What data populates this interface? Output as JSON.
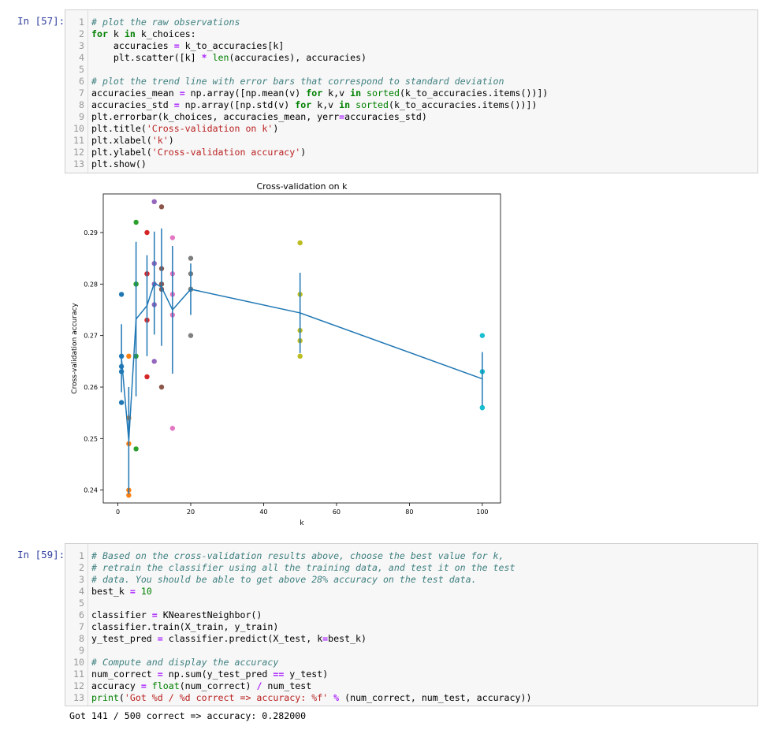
{
  "cell1": {
    "prompt": "In [57]:",
    "lines": [
      {
        "n": "1",
        "parts": [
          [
            "cm",
            "# plot the raw observations"
          ]
        ]
      },
      {
        "n": "2",
        "parts": [
          [
            "kw",
            "for"
          ],
          [
            "code",
            " k "
          ],
          [
            "kw",
            "in"
          ],
          [
            "code",
            " k_choices:"
          ]
        ]
      },
      {
        "n": "3",
        "parts": [
          [
            "code",
            "    accuracies "
          ],
          [
            "op",
            "="
          ],
          [
            "code",
            " k_to_accuracies[k]"
          ]
        ]
      },
      {
        "n": "4",
        "parts": [
          [
            "code",
            "    plt.scatter([k] "
          ],
          [
            "op",
            "*"
          ],
          [
            "code",
            " "
          ],
          [
            "bi",
            "len"
          ],
          [
            "code",
            "(accuracies), accuracies)"
          ]
        ]
      },
      {
        "n": "5",
        "parts": [
          [
            "code",
            ""
          ]
        ]
      },
      {
        "n": "6",
        "parts": [
          [
            "cm",
            "# plot the trend line with error bars that correspond to standard deviation"
          ]
        ]
      },
      {
        "n": "7",
        "parts": [
          [
            "code",
            "accuracies_mean "
          ],
          [
            "op",
            "="
          ],
          [
            "code",
            " np.array([np.mean(v) "
          ],
          [
            "kw",
            "for"
          ],
          [
            "code",
            " k,v "
          ],
          [
            "kw",
            "in"
          ],
          [
            "code",
            " "
          ],
          [
            "bi",
            "sorted"
          ],
          [
            "code",
            "(k_to_accuracies.items())])"
          ]
        ]
      },
      {
        "n": "8",
        "parts": [
          [
            "code",
            "accuracies_std "
          ],
          [
            "op",
            "="
          ],
          [
            "code",
            " np.array([np.std(v) "
          ],
          [
            "kw",
            "for"
          ],
          [
            "code",
            " k,v "
          ],
          [
            "kw",
            "in"
          ],
          [
            "code",
            " "
          ],
          [
            "bi",
            "sorted"
          ],
          [
            "code",
            "(k_to_accuracies.items())])"
          ]
        ]
      },
      {
        "n": "9",
        "parts": [
          [
            "code",
            "plt.errorbar(k_choices, accuracies_mean, yerr"
          ],
          [
            "op",
            "="
          ],
          [
            "code",
            "accuracies_std)"
          ]
        ]
      },
      {
        "n": "10",
        "parts": [
          [
            "code",
            "plt.title("
          ],
          [
            "st",
            "'Cross-validation on k'"
          ],
          [
            "code",
            ")"
          ]
        ]
      },
      {
        "n": "11",
        "parts": [
          [
            "code",
            "plt.xlabel("
          ],
          [
            "st",
            "'k'"
          ],
          [
            "code",
            ")"
          ]
        ]
      },
      {
        "n": "12",
        "parts": [
          [
            "code",
            "plt.ylabel("
          ],
          [
            "st",
            "'Cross-validation accuracy'"
          ],
          [
            "code",
            ")"
          ]
        ]
      },
      {
        "n": "13",
        "parts": [
          [
            "code",
            "plt.show()"
          ]
        ]
      }
    ]
  },
  "cell2": {
    "prompt": "In [59]:",
    "lines": [
      {
        "n": "1",
        "parts": [
          [
            "cm",
            "# Based on the cross-validation results above, choose the best value for k,"
          ]
        ]
      },
      {
        "n": "2",
        "parts": [
          [
            "cm",
            "# retrain the classifier using all the training data, and test it on the test"
          ]
        ]
      },
      {
        "n": "3",
        "parts": [
          [
            "cm",
            "# data. You should be able to get above 28% accuracy on the test data."
          ]
        ]
      },
      {
        "n": "4",
        "parts": [
          [
            "code",
            "best_k "
          ],
          [
            "op",
            "="
          ],
          [
            "code",
            " "
          ],
          [
            "nu",
            "10"
          ]
        ]
      },
      {
        "n": "5",
        "parts": [
          [
            "code",
            ""
          ]
        ]
      },
      {
        "n": "6",
        "parts": [
          [
            "code",
            "classifier "
          ],
          [
            "op",
            "="
          ],
          [
            "code",
            " KNearestNeighbor()"
          ]
        ]
      },
      {
        "n": "7",
        "parts": [
          [
            "code",
            "classifier.train(X_train, y_train)"
          ]
        ]
      },
      {
        "n": "8",
        "parts": [
          [
            "code",
            "y_test_pred "
          ],
          [
            "op",
            "="
          ],
          [
            "code",
            " classifier.predict(X_test, k"
          ],
          [
            "op",
            "="
          ],
          [
            "code",
            "best_k)"
          ]
        ]
      },
      {
        "n": "9",
        "parts": [
          [
            "code",
            ""
          ]
        ]
      },
      {
        "n": "10",
        "parts": [
          [
            "cm",
            "# Compute and display the accuracy"
          ]
        ]
      },
      {
        "n": "11",
        "parts": [
          [
            "code",
            "num_correct "
          ],
          [
            "op",
            "="
          ],
          [
            "code",
            " np.sum(y_test_pred "
          ],
          [
            "op",
            "=="
          ],
          [
            "code",
            " y_test)"
          ]
        ]
      },
      {
        "n": "12",
        "parts": [
          [
            "code",
            "accuracy "
          ],
          [
            "op",
            "="
          ],
          [
            "code",
            " "
          ],
          [
            "bi",
            "float"
          ],
          [
            "code",
            "(num_correct) "
          ],
          [
            "op",
            "/"
          ],
          [
            "code",
            " num_test"
          ]
        ]
      },
      {
        "n": "13",
        "parts": [
          [
            "bi",
            "print"
          ],
          [
            "code",
            "("
          ],
          [
            "st",
            "'Got %d / %d correct => accuracy: %f'"
          ],
          [
            "code",
            " "
          ],
          [
            "op",
            "%"
          ],
          [
            "code",
            " (num_correct, num_test, accuracy))"
          ]
        ]
      }
    ],
    "output": "Got 141 / 500 correct => accuracy: 0.282000"
  },
  "chart_data": {
    "type": "scatter",
    "title": "Cross-validation on k",
    "xlabel": "k",
    "ylabel": "Cross-validation accuracy",
    "xlim": [
      -4,
      105
    ],
    "ylim": [
      0.2375,
      0.2975
    ],
    "xticks": [
      0,
      20,
      40,
      60,
      80,
      100
    ],
    "yticks": [
      0.24,
      0.25,
      0.26,
      0.27,
      0.28,
      0.29
    ],
    "grid": false,
    "series": [
      {
        "k": 1,
        "color": "#1f77b4",
        "values": [
          0.263,
          0.257,
          0.264,
          0.278,
          0.266
        ]
      },
      {
        "k": 3,
        "color": "#ff7f0e",
        "values": [
          0.239,
          0.249,
          0.24,
          0.266,
          0.254
        ]
      },
      {
        "k": 5,
        "color": "#2ca02c",
        "values": [
          0.248,
          0.266,
          0.28,
          0.292,
          0.28
        ]
      },
      {
        "k": 8,
        "color": "#d62728",
        "values": [
          0.262,
          0.282,
          0.273,
          0.29,
          0.282
        ]
      },
      {
        "k": 10,
        "color": "#9467bd",
        "values": [
          0.265,
          0.296,
          0.276,
          0.284,
          0.28
        ]
      },
      {
        "k": 12,
        "color": "#8c564b",
        "values": [
          0.26,
          0.295,
          0.279,
          0.283,
          0.28
        ]
      },
      {
        "k": 15,
        "color": "#e377c2",
        "values": [
          0.252,
          0.289,
          0.278,
          0.282,
          0.274
        ]
      },
      {
        "k": 20,
        "color": "#7f7f7f",
        "values": [
          0.27,
          0.279,
          0.279,
          0.282,
          0.285
        ]
      },
      {
        "k": 50,
        "color": "#bcbd22",
        "values": [
          0.271,
          0.278,
          0.269,
          0.266,
          0.288
        ]
      },
      {
        "k": 100,
        "color": "#17becf",
        "values": [
          0.256,
          0.263,
          0.263,
          0.256,
          0.27
        ]
      }
    ],
    "trend": {
      "color": "#1f77b4",
      "x": [
        1,
        3,
        5,
        8,
        10,
        12,
        15,
        20,
        50,
        100
      ],
      "mean": [
        0.2656,
        0.2496,
        0.2732,
        0.2758,
        0.2802,
        0.2794,
        0.275,
        0.279,
        0.2744,
        0.2616
      ],
      "std": [
        0.0066,
        0.0104,
        0.015,
        0.0098,
        0.01,
        0.0114,
        0.0124,
        0.005,
        0.0078,
        0.0052
      ]
    }
  }
}
